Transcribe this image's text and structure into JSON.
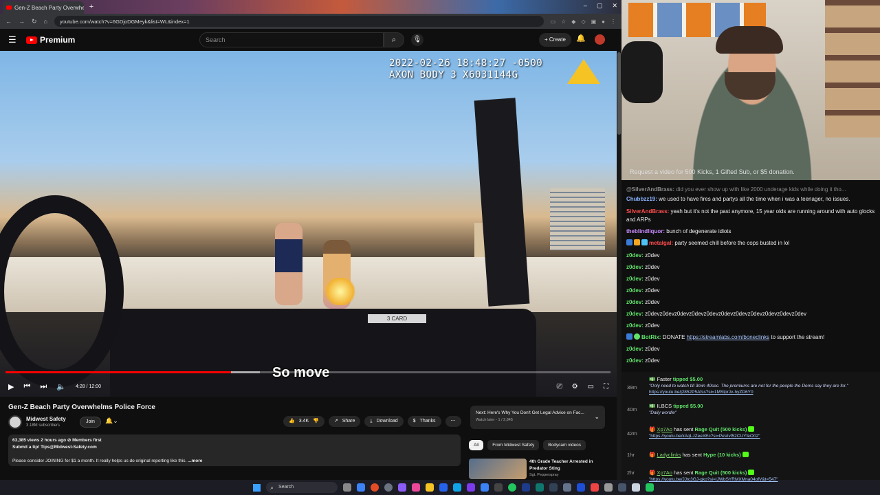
{
  "browser": {
    "tab_title": "Gen-Z Beach Party Overwhelm",
    "url": "youtube.com/watch?v=6GDjoDGMeyk&list=WL&index=1"
  },
  "youtube": {
    "logo": "Premium",
    "search_placeholder": "Search",
    "create_label": "Create"
  },
  "video": {
    "stamp_line1": "2022-02-26 18:48:27 -0500",
    "stamp_line2": "AXON BODY 3 X6031144G",
    "card_label": "3 CARD",
    "subtitle": "So move",
    "time": "4:28 / 12:00",
    "progress": 0.373,
    "buffered": 0.42
  },
  "details": {
    "title": "Gen-Z Beach Party Overwhelms Police Force",
    "channel": "Midwest Safety",
    "subscribers": "3.18M subscribers",
    "join": "Join",
    "likes": "3.4K",
    "share": "Share",
    "download": "Download",
    "thanks": "Thanks",
    "views_line": "63,385 views  2 hours ago  ⊘ Members first",
    "tip_line": "Submit a tip! Tips@Midwest-Safety.com",
    "body_line": "Please consider JOINING for $1 a month. It really helps us do original reporting like this.",
    "more": "...more"
  },
  "next": {
    "title": "Next: Here's Why You Don't Get Legal Advice on Fac...",
    "sub": "Watch later - 1 / 2,845"
  },
  "chips": [
    "All",
    "From Midwest Safety",
    "Bodycam videos"
  ],
  "rec": {
    "title": "4th Grade Teacher Arrested in Predator Sting",
    "channel": "Sgt. Pepperspray"
  },
  "taskbar": {
    "search": "Search"
  },
  "stream": {
    "caption": "Request a video for 500 Kicks, 1 Gifted Sub, or $5 donation."
  },
  "chat": [
    {
      "user": "@SilverAndBrass:",
      "text": "did you ever show up with like 2000 underage kids while doing it tho..."
    },
    {
      "user": "Chubbzz19:",
      "text": "we used to have fires and partys all the time when i was a teenager, no issues."
    },
    {
      "user": "SilverAndBrass:",
      "text": "yeah but it's not the past anymore, 15 year olds are running around with auto glocks and ARPs"
    },
    {
      "user": "theblindliquor:",
      "text": "bunch of degenerate idiots"
    },
    {
      "user": "metalgal:",
      "text": "party seemed chill before the cops busted in lol"
    },
    {
      "user": "z0dev:",
      "text": "z0dev"
    },
    {
      "user": "z0dev:",
      "text": "z0dev"
    },
    {
      "user": "z0dev:",
      "text": "z0dev"
    },
    {
      "user": "z0dev:",
      "text": "z0dev"
    },
    {
      "user": "z0dev:",
      "text": "z0dev"
    },
    {
      "user": "z0dev:",
      "text": "z0devz0devz0devz0devz0devz0devz0devz0devz0devz0devz0dev"
    },
    {
      "user": "z0dev:",
      "text": "z0dev"
    },
    {
      "user": "BotRix:",
      "text": "DONATE",
      "link": "https://streamlabs.com/boneclinks",
      "after": "to support the stream!"
    },
    {
      "user": "z0dev:",
      "text": "z0dev"
    },
    {
      "user": "z0dev:",
      "text": "z0dev"
    }
  ],
  "events": [
    {
      "time": "39m",
      "name": "Faster",
      "action": "tipped $5.00",
      "quote": "\"Only need to watch till 3min 40sec. The premiums are not for the people the Dems say they are for.\"",
      "link": "https://youtu.be/j2852P5Afss?si=1MStprJv-hyZD6Y0"
    },
    {
      "time": "40m",
      "name": "ILBCS",
      "action": "tipped $5.00",
      "quote": "\"Daily wordle\"",
      "link": ""
    },
    {
      "time": "42m",
      "name": "Xp7Ao",
      "action": "has sent Rage Quit (500 kicks)",
      "quote": "",
      "link": "\"https://youtu.be/kAqLJZeeXEc?si=PeVivf52CUYfeO02\""
    },
    {
      "time": "1hr",
      "name": "Ladyclinks",
      "action": "has sent Hype (10 kicks)",
      "quote": "",
      "link": ""
    },
    {
      "time": "2hr",
      "name": "Xp7Ao",
      "action": "has sent Rage Quit (500 kicks)",
      "quote": "",
      "link": "\"https://youtu.be/JJtc3GJ-gko?si=IJWbSYRMXMna04ofV&t=547\""
    }
  ]
}
